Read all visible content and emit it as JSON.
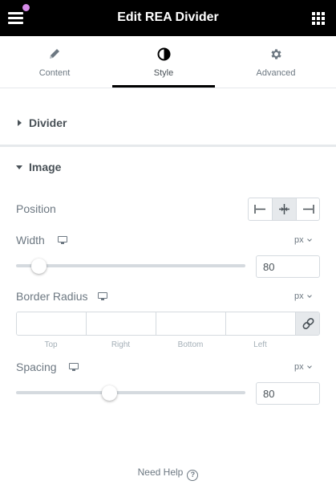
{
  "header": {
    "title": "Edit REA Divider"
  },
  "tabs": [
    {
      "label": "Content",
      "icon": "pencil-icon"
    },
    {
      "label": "Style",
      "icon": "contrast-icon",
      "active": true
    },
    {
      "label": "Advanced",
      "icon": "gear-icon"
    }
  ],
  "sections": {
    "divider": {
      "label": "Divider",
      "expanded": false
    },
    "image": {
      "label": "Image",
      "expanded": true
    }
  },
  "controls": {
    "position": {
      "label": "Position",
      "options": [
        "left",
        "center",
        "right"
      ],
      "selected": "center"
    },
    "width": {
      "label": "Width",
      "unit": "px",
      "value": "80",
      "slider_fraction": 0.07
    },
    "border_radius": {
      "label": "Border Radius",
      "unit": "px",
      "fields": [
        {
          "label": "Top",
          "value": ""
        },
        {
          "label": "Right",
          "value": ""
        },
        {
          "label": "Bottom",
          "value": ""
        },
        {
          "label": "Left",
          "value": ""
        }
      ],
      "linked": true
    },
    "spacing": {
      "label": "Spacing",
      "unit": "px",
      "value": "80",
      "slider_fraction": 0.4
    }
  },
  "footer": {
    "help_label": "Need Help",
    "help_glyph": "?"
  },
  "colors": {
    "header_bg": "#000000",
    "notify_dot": "#d68be8",
    "active_tab_line": "#000000"
  }
}
